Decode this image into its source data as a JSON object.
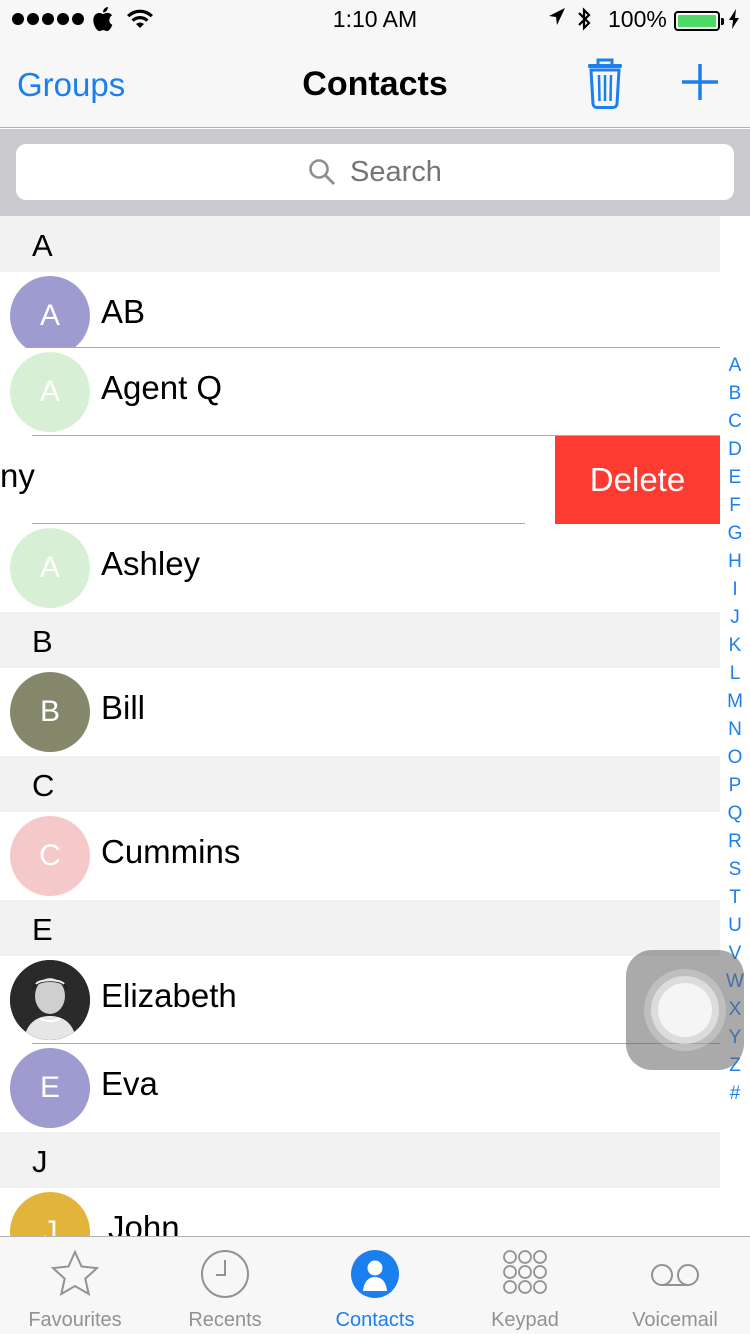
{
  "status_bar": {
    "time": "1:10 AM",
    "battery_percent": "100%",
    "battery_level": 1.0,
    "icons": [
      "signal-dots-icon",
      "apple-logo-icon",
      "wifi-icon",
      "location-arrow-icon",
      "bluetooth-icon",
      "battery-icon",
      "charging-bolt-icon"
    ]
  },
  "nav": {
    "left_label": "Groups",
    "title": "Contacts"
  },
  "search": {
    "placeholder": "Search"
  },
  "list": {
    "sections": [
      {
        "letter": "A"
      },
      {
        "letter": "B"
      },
      {
        "letter": "C"
      },
      {
        "letter": "E"
      },
      {
        "letter": "J"
      }
    ],
    "rows": [
      {
        "initial": "A",
        "name": "AB",
        "avatar_color": "#9e9bd1"
      },
      {
        "initial": "A",
        "name": "Agent Q",
        "avatar_color": "#d7f0d5"
      },
      {
        "initial": "",
        "name": "ny",
        "avatar_color": ""
      },
      {
        "initial": "A",
        "name": "Ashley",
        "avatar_color": "#d7f0d5"
      },
      {
        "initial": "B",
        "name": "Bill",
        "avatar_color": "#84876a"
      },
      {
        "initial": "C",
        "name": "Cummins",
        "avatar_color": "#f5c9c9"
      },
      {
        "initial": "",
        "name": "Elizabeth",
        "avatar_color": "#222222"
      },
      {
        "initial": "E",
        "name": "Eva",
        "avatar_color": "#9e9bd1"
      },
      {
        "initial": "J",
        "name": "John",
        "avatar_color": "#e3b43a"
      }
    ],
    "delete_label": "Delete"
  },
  "index_letters": [
    "A",
    "B",
    "C",
    "D",
    "E",
    "F",
    "G",
    "H",
    "I",
    "J",
    "K",
    "L",
    "M",
    "N",
    "O",
    "P",
    "Q",
    "R",
    "S",
    "T",
    "U",
    "V",
    "W",
    "X",
    "Y",
    "Z",
    "#"
  ],
  "tabs": [
    {
      "label": "Favourites",
      "icon": "star-icon"
    },
    {
      "label": "Recents",
      "icon": "clock-icon"
    },
    {
      "label": "Contacts",
      "icon": "person-circle-icon"
    },
    {
      "label": "Keypad",
      "icon": "keypad-icon"
    },
    {
      "label": "Voicemail",
      "icon": "voicemail-icon"
    }
  ],
  "colors": {
    "accent": "#1b7ff0",
    "delete": "#fd3b31",
    "battery": "#4cd964"
  }
}
